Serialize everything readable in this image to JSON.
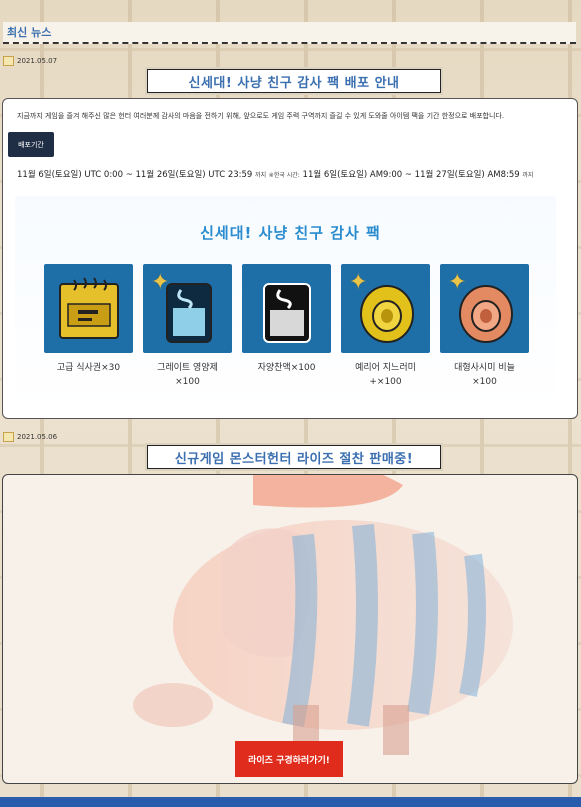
{
  "header": {
    "title": "최신 뉴스"
  },
  "news": [
    {
      "date": "2021.05.07",
      "title": "신세대! 사냥 친구 감사 팩 배포 안내",
      "intro": "지금까지 게임을 즐겨 해주신 많은 헌터 여러분께 감사의 마음을 전하기 위해, 앞으로도 게임 주력 구역까지 즐길 수 있게 도와줄 아이템 팩을 기간 한정으로 배포합니다.",
      "badge": "배포기간",
      "period_main": "11월 6일(토요일) UTC 0:00 ~ 11월 26일(토요일) UTC 23:59",
      "period_note_1": "까지",
      "period_note_2": "※한국 시간:",
      "period_kst": "11월 6일(토요일) AM9:00 ~ 11월 27일(토요일) AM8:59",
      "period_note_3": "까지",
      "banner_title": "신세대! 사냥 친구 감사 팩",
      "items": [
        {
          "name": "고급 식사권×30",
          "qty": "",
          "icon": "meal-ticket-icon"
        },
        {
          "name": "그레이트 영양제",
          "qty": "×100",
          "icon": "nutrient-bottle-icon"
        },
        {
          "name": "자양찬액×100",
          "qty": "",
          "icon": "tonic-bottle-icon"
        },
        {
          "name": "예리어 지느러미",
          "qty": "+×100",
          "icon": "fin-coin-icon"
        },
        {
          "name": "대형사시미 비늘",
          "qty": "×100",
          "icon": "scale-coin-icon"
        }
      ]
    },
    {
      "date": "2021.05.06",
      "title": "신규게임 몬스터헌터 라이즈 절찬 판매중!",
      "cta": "라이즈 구경하러가기!"
    }
  ],
  "colors": {
    "accent": "#3b6fb0",
    "badge_bg": "#1f2d45",
    "item_bg": "#1e6fa8",
    "cta_bg": "#e02c1d",
    "bottom_bar": "#2a5cae"
  }
}
